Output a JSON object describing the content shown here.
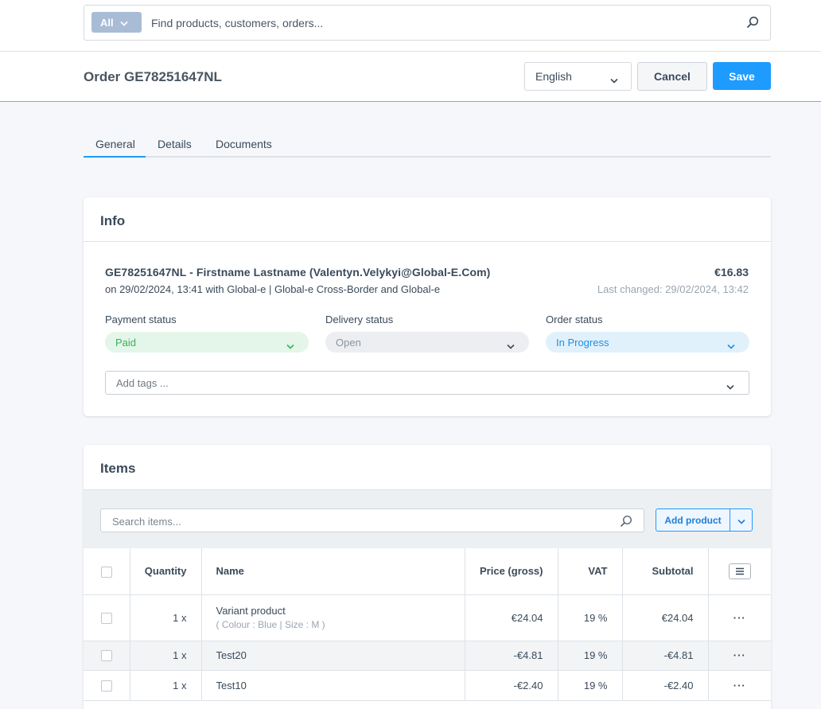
{
  "search": {
    "scope": "All",
    "placeholder": "Find products, customers, orders..."
  },
  "header": {
    "title": "Order GE78251647NL",
    "language": "English",
    "cancel_label": "Cancel",
    "save_label": "Save"
  },
  "tabs": [
    "General",
    "Details",
    "Documents"
  ],
  "info": {
    "title": "Info",
    "order_line": "GE78251647NL - Firstname Lastname (Valentyn.Velykyi@Global-E.Com)",
    "order_sub": "on 29/02/2024, 13:41 with Global-e | Global-e Cross-Border and Global-e",
    "total": "€16.83",
    "last_changed": "Last changed: 29/02/2024, 13:42",
    "payment_status_label": "Payment status",
    "payment_status": "Paid",
    "delivery_status_label": "Delivery status",
    "delivery_status": "Open",
    "order_status_label": "Order status",
    "order_status": "In Progress",
    "tags_placeholder": "Add tags ..."
  },
  "items": {
    "title": "Items",
    "search_placeholder": "Search items...",
    "add_product_label": "Add product",
    "columns": {
      "quantity": "Quantity",
      "name": "Name",
      "price": "Price (gross)",
      "vat": "VAT",
      "subtotal": "Subtotal"
    },
    "rows": [
      {
        "qty": "1 x",
        "name": "Variant product",
        "variant": "( Colour : Blue | Size : M )",
        "price": "€24.04",
        "vat": "19 %",
        "subtotal": "€24.04",
        "actions": "···"
      },
      {
        "qty": "1 x",
        "name": "Test20",
        "price": "-€4.81",
        "vat": "19 %",
        "subtotal": "-€4.81",
        "actions": "···"
      },
      {
        "qty": "1 x",
        "name": "Test10",
        "price": "-€2.40",
        "vat": "19 %",
        "subtotal": "-€2.40",
        "actions": "···"
      }
    ]
  },
  "colors": {
    "accent": "#1e9bff",
    "paid_bg": "#e4f6e9",
    "paid_text": "#3ab25a",
    "in_progress_bg": "#e1f1fc",
    "in_progress_text": "#1f8fdf"
  }
}
